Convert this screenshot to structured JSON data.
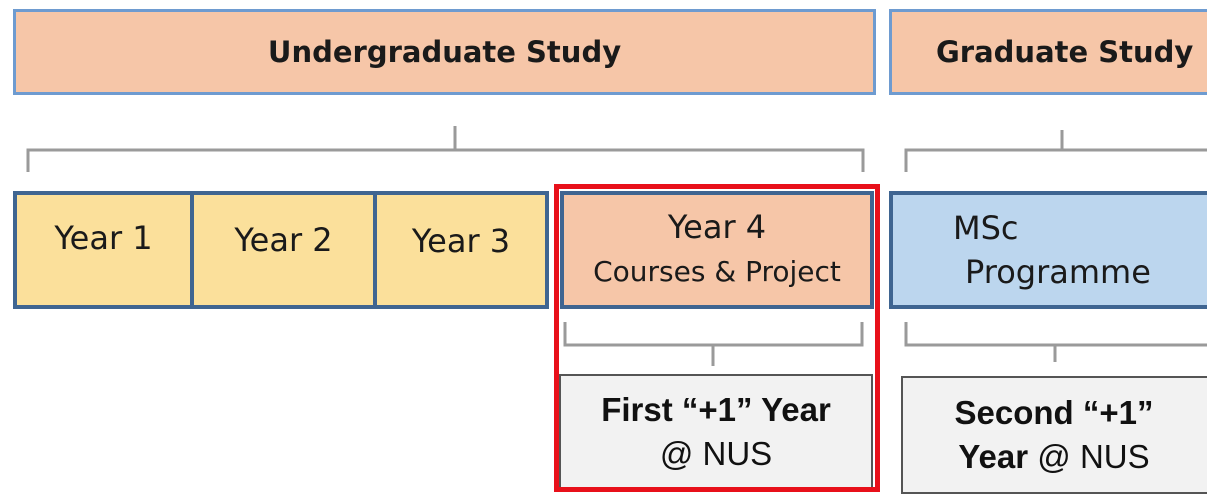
{
  "headers": {
    "undergraduate": "Undergraduate Study",
    "graduate": "Graduate Study"
  },
  "years": {
    "year1": "Year 1",
    "year2": "Year 2",
    "year3": "Year 3",
    "year4_line1": "Year 4",
    "year4_line2": "Courses & Project"
  },
  "msc": {
    "line1": "MSc",
    "line2": "Programme"
  },
  "plus_one": {
    "first_bold": "First “+1” Year",
    "first_rest": "@ NUS",
    "second_bold_line1": "Second “+1”",
    "second_bold_line2": "Year",
    "second_rest": " @ NUS"
  },
  "colors": {
    "header_fill": "#f6c6a8",
    "year_fill": "#fbe09b",
    "msc_fill": "#bcd6ee",
    "box_border": "#3f6591",
    "highlight": "#e8101a"
  }
}
